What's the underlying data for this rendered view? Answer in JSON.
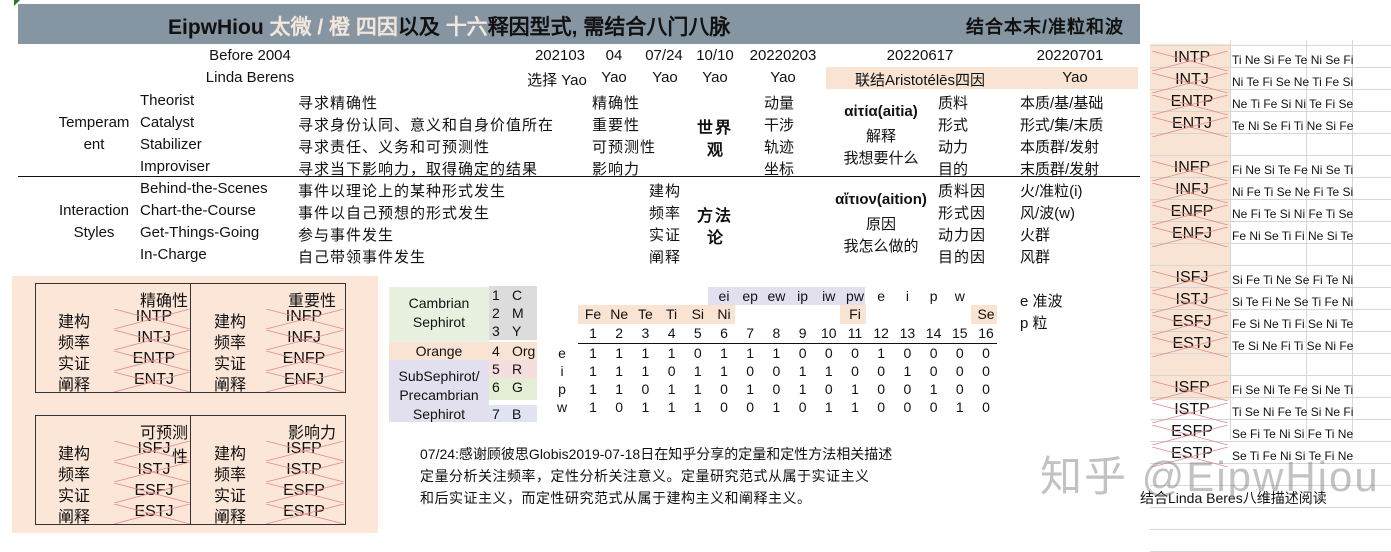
{
  "title": {
    "left_parts": [
      {
        "text": "EipwHiou ",
        "highlight": false
      },
      {
        "text": "太微 / 橙 四因",
        "highlight": true
      },
      {
        "text": "以及 ",
        "highlight": false
      },
      {
        "text": "十六",
        "highlight": true
      },
      {
        "text": "释因型式, 需结合八门八脉",
        "highlight": false
      }
    ],
    "right": "结合本末/准粒和波",
    "bar_color": "#8596a2",
    "highlight_color": "#f3e6dc"
  },
  "header": {
    "before": "Before 2004",
    "author": "Linda Berens",
    "dates": [
      "202103",
      "04",
      "07/24",
      "10/10",
      "20220203",
      "20220617",
      "20220701"
    ],
    "row2": [
      "选择 Yao",
      "Yao",
      "Yao",
      "Yao",
      "Yao",
      "联结Aristotélēs四因",
      "Yao"
    ]
  },
  "temperament": {
    "group_label": "Temperam\nent",
    "group_line1": "Temperam",
    "group_line2": "ent",
    "rows": [
      {
        "type": "Theorist",
        "desc": "寻求精确性",
        "key": "精确性",
        "col5": "动量",
        "cause": "质料",
        "mapping": "本质/基/基础"
      },
      {
        "type": "Catalyst",
        "desc": "寻求身份认同、意义和自身价值所在",
        "key": "重要性",
        "col5": "干涉",
        "cause": "形式",
        "mapping": "形式/集/末质"
      },
      {
        "type": "Stabilizer",
        "desc": "寻求责任、义务和可预测性",
        "key": "可预测性",
        "col5": "轨迹",
        "cause": "动力",
        "mapping": "本质群/发射"
      },
      {
        "type": "Improviser",
        "desc": "寻求当下影响力，取得确定的结果",
        "key": "影响力",
        "col5": "坐标",
        "cause": "目的",
        "mapping": "末质群/发射"
      }
    ],
    "worldview_line1": "世界",
    "worldview_line2": "观",
    "aitia_title": "αἰτία(aitia)",
    "aitia_line2": "解释",
    "aitia_line3": "我想要什么"
  },
  "interaction": {
    "group_line1": "Interaction",
    "group_line2": "Styles",
    "rows": [
      {
        "type": "Behind-the-Scenes",
        "desc": "事件以理论上的某种形式发生",
        "method": "建构",
        "cause": "质料因",
        "mapping": "火/准粒(i)"
      },
      {
        "type": "Chart-the-Course",
        "desc": "事件以自己预想的形式发生",
        "method": "频率",
        "cause": "形式因",
        "mapping": "风/波(w)"
      },
      {
        "type": "Get-Things-Going",
        "desc": "参与事件发生",
        "method": "实证",
        "cause": "动力因",
        "mapping": "火群"
      },
      {
        "type": "In-Charge",
        "desc": "自己带领事件发生",
        "method": "阐释",
        "cause": "目的因",
        "mapping": "风群"
      }
    ],
    "methodology_line1": "方法",
    "methodology_line2": "论",
    "aition_title": "αἴτιον(aition)",
    "aition_line2": "原因",
    "aition_line3": "我怎么做的"
  },
  "boxes": [
    {
      "header_left": "精确性",
      "header_right": "重要性",
      "rows": [
        {
          "label": "建构",
          "left": "INTP",
          "label2": "建构",
          "right": "INFP"
        },
        {
          "label": "频率",
          "left": "INTJ",
          "label2": "频率",
          "right": "INFJ"
        },
        {
          "label": "实证",
          "left": "ENTP",
          "label2": "实证",
          "right": "ENFP"
        },
        {
          "label": "阐释",
          "left": "ENTJ",
          "label2": "阐释",
          "right": "ENFJ"
        }
      ]
    },
    {
      "header_left": "可预测性",
      "header_right": "影响力",
      "rows": [
        {
          "label": "建构",
          "left": "ISFJ",
          "label2": "建构",
          "right": "ISFP"
        },
        {
          "label": "频率",
          "left": "ISTJ",
          "label2": "频率",
          "right": "ISTP"
        },
        {
          "label": "实证",
          "left": "ESFJ",
          "label2": "实证",
          "right": "ESFP"
        },
        {
          "label": "阐释",
          "left": "ESTJ",
          "label2": "阐释",
          "right": "ESTP"
        }
      ]
    }
  ],
  "sephirot": {
    "groups": [
      {
        "label_line1": "Cambrian",
        "label_line2": "Sephirot",
        "color": "#e8f1e0"
      },
      {
        "label_line1": "Orange",
        "label_line2": "",
        "color": "#f9e3d3"
      },
      {
        "label_line1": "SubSephirot/",
        "label_line2": "Precambrian",
        "label_line3": "Sephirot",
        "color": "#e2e0ef"
      }
    ],
    "items": [
      {
        "num": "1",
        "code": "C",
        "color": "#dcdcdc"
      },
      {
        "num": "2",
        "code": "M",
        "color": "#dcdcdc"
      },
      {
        "num": "3",
        "code": "Y",
        "color": "#dcdcdc"
      },
      {
        "num": "4",
        "code": "Org",
        "color": "#f9e3d3"
      },
      {
        "num": "5",
        "code": "R",
        "color": "#f7dede"
      },
      {
        "num": "6",
        "code": "G",
        "color": "#e3eed4"
      },
      {
        "num": "7",
        "code": "B",
        "color": "#e0e4f2"
      }
    ]
  },
  "matrix": {
    "combo_row": [
      "",
      "",
      "",
      "",
      "",
      "ei",
      "ep",
      "ew",
      "ip",
      "iw",
      "pw",
      "e",
      "i",
      "p",
      "w",
      ""
    ],
    "function_row": [
      "Fe",
      "Ne",
      "Te",
      "Ti",
      "Si",
      "Ni",
      "",
      "",
      "",
      "",
      "Fi",
      "",
      "",
      "",
      "",
      "Se"
    ],
    "columns": [
      "1",
      "2",
      "3",
      "4",
      "5",
      "6",
      "7",
      "8",
      "9",
      "10",
      "11",
      "12",
      "13",
      "14",
      "15",
      "16"
    ],
    "rows": [
      {
        "label": "e",
        "values": [
          "1",
          "1",
          "1",
          "1",
          "0",
          "1",
          "1",
          "1",
          "0",
          "0",
          "0",
          "1",
          "0",
          "0",
          "0",
          "0"
        ]
      },
      {
        "label": "i",
        "values": [
          "1",
          "1",
          "1",
          "0",
          "1",
          "1",
          "0",
          "0",
          "1",
          "1",
          "0",
          "0",
          "1",
          "0",
          "0",
          "0"
        ]
      },
      {
        "label": "p",
        "values": [
          "1",
          "1",
          "0",
          "1",
          "1",
          "0",
          "1",
          "0",
          "1",
          "0",
          "1",
          "0",
          "0",
          "1",
          "0",
          "0"
        ]
      },
      {
        "label": "w",
        "values": [
          "1",
          "0",
          "1",
          "1",
          "1",
          "0",
          "0",
          "1",
          "0",
          "1",
          "1",
          "0",
          "0",
          "0",
          "1",
          "0"
        ]
      }
    ],
    "legend": [
      "e 准波",
      "p 粒"
    ]
  },
  "note": {
    "line1": "07/24:感谢顾彼思Globis2019-07-18日在知乎分享的定量和定性方法相关描述",
    "line2": "定量分析关注频率，定性分析关注意义。定量研究范式从属于实证主义",
    "line3": "和后实证主义，而定性研究范式从属于建构主义和阐释主义。"
  },
  "right_panel": {
    "groups": [
      [
        {
          "type": "INTP",
          "seq": "Ti Ne Si Fe Te Ni Se Fi"
        },
        {
          "type": "INTJ",
          "seq": "Ni Te Fi Se Ne Ti Fe Si"
        },
        {
          "type": "ENTP",
          "seq": "Ne Ti Fe Si Ni Te Fi Se"
        },
        {
          "type": "ENTJ",
          "seq": "Te Ni Se Fi Ti Ne Si Fe"
        }
      ],
      [
        {
          "type": "INFP",
          "seq": "Fi Ne Si Te Fe Ni Se Ti"
        },
        {
          "type": "INFJ",
          "seq": "Ni Fe Ti Se Ne Fi Te Si"
        },
        {
          "type": "ENFP",
          "seq": "Ne Fi Te Si Ni Fe Ti Se"
        },
        {
          "type": "ENFJ",
          "seq": "Fe Ni Se Ti Fi Ne Si Te"
        }
      ],
      [
        {
          "type": "ISFJ",
          "seq": "Si Fe Ti Ne Se Fi Te Ni"
        },
        {
          "type": "ISTJ",
          "seq": "Si Te Fi Ne Se Ti Fe Ni"
        },
        {
          "type": "ESFJ",
          "seq": "Fe Si Ne Ti Fi Se Ni Te"
        },
        {
          "type": "ESTJ",
          "seq": "Te Si Ne Fi Ti Se Ni Fe"
        }
      ],
      [
        {
          "type": "ISFP",
          "seq": "Fi Se Ni Te Fe Si Ne Ti"
        },
        {
          "type": "ISTP",
          "seq": "Ti Se Ni Fe Te Si Ne Fi"
        },
        {
          "type": "ESFP",
          "seq": "Se Fi Te Ni Si Fe Ti Ne"
        },
        {
          "type": "ESTP",
          "seq": "Se Ti Fe Ni Si Te Fi Ne"
        }
      ]
    ],
    "caption": "结合Linda Beres八维描述阅读"
  },
  "watermark": "知乎 @EipwHiou"
}
